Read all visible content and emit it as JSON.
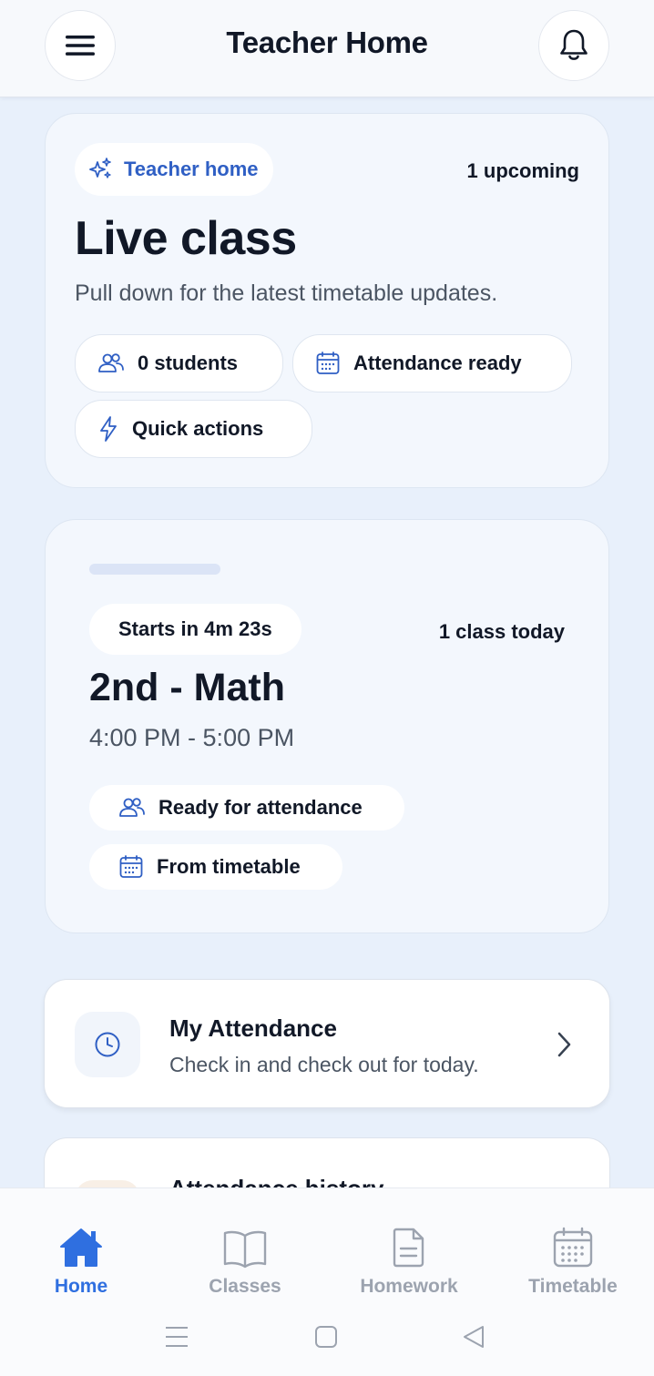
{
  "header": {
    "title": "Teacher Home",
    "menu_icon": "hamburger-menu-icon",
    "bell_icon": "bell-icon"
  },
  "hero": {
    "badge": "Teacher home",
    "upcoming": "1 upcoming",
    "title": "Live class",
    "subtitle": "Pull down for the latest timetable updates.",
    "chips": {
      "students": "0 students",
      "attendance": "Attendance ready",
      "quick": "Quick actions"
    }
  },
  "class_card": {
    "starts_in": "Starts in 4m 23s",
    "today": "1 class today",
    "title": "2nd - Math",
    "time": "4:00 PM - 5:00 PM",
    "ready": "Ready for attendance",
    "source": "From timetable"
  },
  "my_attendance": {
    "title": "My Attendance",
    "subtitle": "Check in and check out for today."
  },
  "attendance_history": {
    "title": "Attendance history"
  },
  "bottom_nav": {
    "items": [
      {
        "label": "Home",
        "icon": "home-icon",
        "active": true
      },
      {
        "label": "Classes",
        "icon": "book-icon",
        "active": false
      },
      {
        "label": "Homework",
        "icon": "document-icon",
        "active": false
      },
      {
        "label": "Timetable",
        "icon": "calendar-icon",
        "active": false
      }
    ]
  },
  "colors": {
    "accent": "#2f6fe0",
    "background": "#e8f0fb",
    "text": "#111827",
    "muted": "#9ca3af"
  }
}
